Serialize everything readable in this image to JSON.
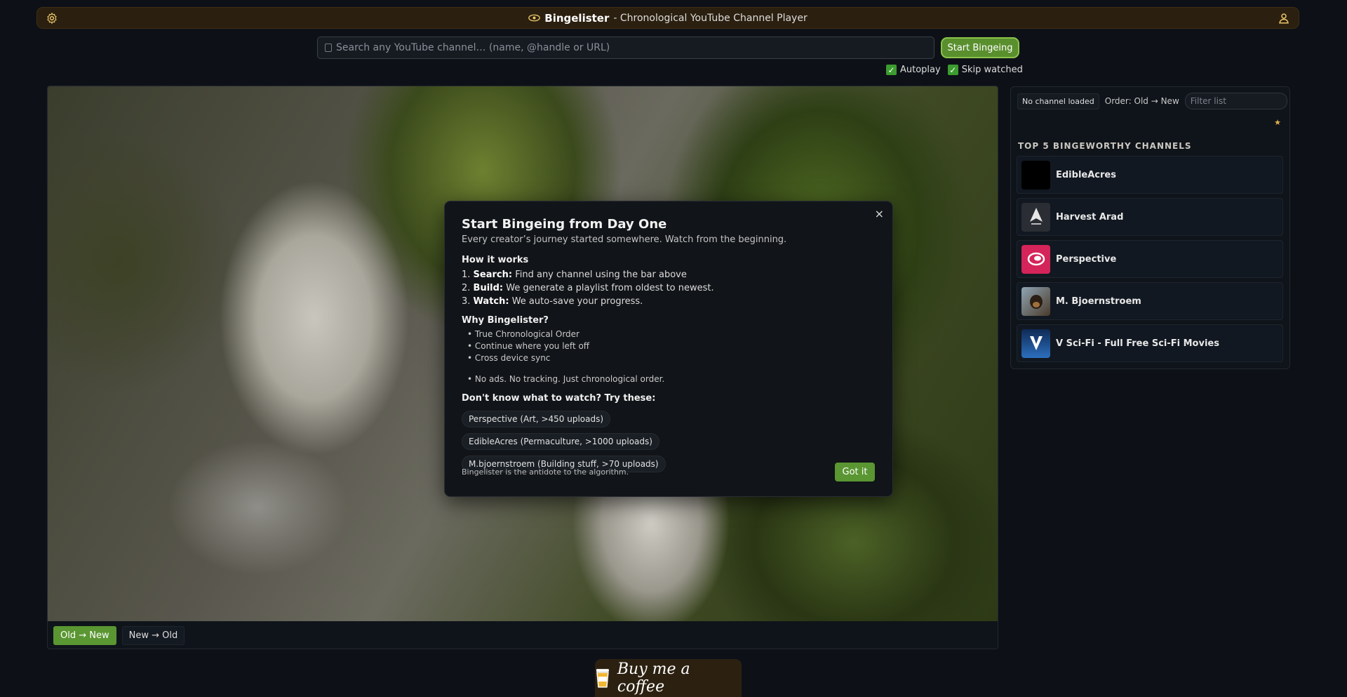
{
  "header": {
    "brand_name": "Bingelister",
    "tagline": " - Chronological YouTube Channel Player"
  },
  "search": {
    "placeholder": "Search any YouTube channel… (name, @handle or URL)",
    "button_label": "Start Bingeing"
  },
  "options": {
    "autoplay_label": "Autoplay",
    "autoplay_checked": true,
    "skip_watched_label": "Skip watched",
    "skip_watched_checked": true
  },
  "player": {
    "order_old_new": "Old → New",
    "order_new_old": "New → Old",
    "active_order": "old_new"
  },
  "sidebar": {
    "status": "No channel loaded",
    "order": "Order: Old → New",
    "filter_placeholder": "Filter list",
    "star": "★",
    "top_title": "TOP 5 BINGEWORTHY CHANNELS",
    "channels": [
      {
        "name": "EdibleAcres",
        "avatar_color": "#000000"
      },
      {
        "name": "Harvest Arad",
        "avatar_color": "#2a2d33"
      },
      {
        "name": "Perspective",
        "avatar_color": "#d4245a"
      },
      {
        "name": "M. Bjoernstroem",
        "avatar_color": "#7a8fa0"
      },
      {
        "name": "V Sci-Fi - Full Free Sci-Fi Movies",
        "avatar_color": "#1f4e8c"
      }
    ]
  },
  "modal": {
    "close": "×",
    "title": "Start Bingeing from Day One",
    "subtitle": "Every creator’s journey started somewhere. Watch from the beginning.",
    "how_heading": "How it works",
    "steps": [
      {
        "num": "1.",
        "key": "Search:",
        "text": " Find any channel using the bar above"
      },
      {
        "num": "2.",
        "key": "Build:",
        "text": " We generate a playlist from oldest to newest."
      },
      {
        "num": "3.",
        "key": "Watch:",
        "text": " We auto-save your progress."
      }
    ],
    "why_heading": "Why Bingelister?",
    "why_items": [
      "True Chronological Order",
      "Continue where you left off",
      "Cross device sync"
    ],
    "extra_item": "No ads. No tracking. Just chronological order.",
    "try_heading": "Don't know what to watch? Try these:",
    "chips": [
      "Perspective (Art, >450 uploads)",
      "EdibleAcres (Permaculture, >1000 uploads)",
      "M.bjoernstroem (Building stuff, >70 uploads)"
    ],
    "footer": "Bingelister is the antidote to the algorithm.",
    "got_it": "Got it"
  },
  "coffee": {
    "label": "Buy me a coffee"
  },
  "colors": {
    "accent_green": "#5a9632",
    "header_bg": "#2b1f0f",
    "page_bg": "#0d1117"
  },
  "icons": {
    "settings": "gear-icon",
    "profile": "user-icon",
    "brand": "eye-logo-icon",
    "coffee": "coffee-cup-icon"
  }
}
